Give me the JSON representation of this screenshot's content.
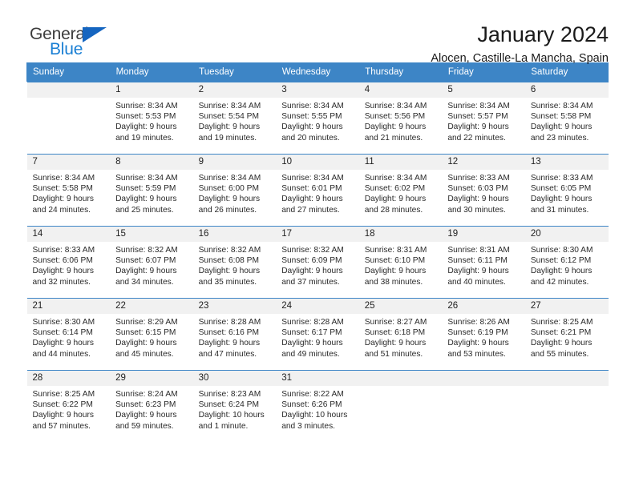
{
  "brand": {
    "name_top": "General",
    "name_bottom": "Blue",
    "accent_color": "#1565c0",
    "blue_text_color": "#1a7fd4"
  },
  "header": {
    "title": "January 2024",
    "subtitle": "Alocen, Castille-La Mancha, Spain"
  },
  "theme": {
    "header_row_bg": "#3d85c6",
    "daynum_bg": "#f1f1f1",
    "grid_line": "#3d85c6"
  },
  "weekdays": [
    "Sunday",
    "Monday",
    "Tuesday",
    "Wednesday",
    "Thursday",
    "Friday",
    "Saturday"
  ],
  "weeks": [
    [
      {
        "day": "",
        "sunrise": "",
        "sunset": "",
        "daylight_line1": "",
        "daylight_line2": ""
      },
      {
        "day": "1",
        "sunrise": "Sunrise: 8:34 AM",
        "sunset": "Sunset: 5:53 PM",
        "daylight_line1": "Daylight: 9 hours",
        "daylight_line2": "and 19 minutes."
      },
      {
        "day": "2",
        "sunrise": "Sunrise: 8:34 AM",
        "sunset": "Sunset: 5:54 PM",
        "daylight_line1": "Daylight: 9 hours",
        "daylight_line2": "and 19 minutes."
      },
      {
        "day": "3",
        "sunrise": "Sunrise: 8:34 AM",
        "sunset": "Sunset: 5:55 PM",
        "daylight_line1": "Daylight: 9 hours",
        "daylight_line2": "and 20 minutes."
      },
      {
        "day": "4",
        "sunrise": "Sunrise: 8:34 AM",
        "sunset": "Sunset: 5:56 PM",
        "daylight_line1": "Daylight: 9 hours",
        "daylight_line2": "and 21 minutes."
      },
      {
        "day": "5",
        "sunrise": "Sunrise: 8:34 AM",
        "sunset": "Sunset: 5:57 PM",
        "daylight_line1": "Daylight: 9 hours",
        "daylight_line2": "and 22 minutes."
      },
      {
        "day": "6",
        "sunrise": "Sunrise: 8:34 AM",
        "sunset": "Sunset: 5:58 PM",
        "daylight_line1": "Daylight: 9 hours",
        "daylight_line2": "and 23 minutes."
      }
    ],
    [
      {
        "day": "7",
        "sunrise": "Sunrise: 8:34 AM",
        "sunset": "Sunset: 5:58 PM",
        "daylight_line1": "Daylight: 9 hours",
        "daylight_line2": "and 24 minutes."
      },
      {
        "day": "8",
        "sunrise": "Sunrise: 8:34 AM",
        "sunset": "Sunset: 5:59 PM",
        "daylight_line1": "Daylight: 9 hours",
        "daylight_line2": "and 25 minutes."
      },
      {
        "day": "9",
        "sunrise": "Sunrise: 8:34 AM",
        "sunset": "Sunset: 6:00 PM",
        "daylight_line1": "Daylight: 9 hours",
        "daylight_line2": "and 26 minutes."
      },
      {
        "day": "10",
        "sunrise": "Sunrise: 8:34 AM",
        "sunset": "Sunset: 6:01 PM",
        "daylight_line1": "Daylight: 9 hours",
        "daylight_line2": "and 27 minutes."
      },
      {
        "day": "11",
        "sunrise": "Sunrise: 8:34 AM",
        "sunset": "Sunset: 6:02 PM",
        "daylight_line1": "Daylight: 9 hours",
        "daylight_line2": "and 28 minutes."
      },
      {
        "day": "12",
        "sunrise": "Sunrise: 8:33 AM",
        "sunset": "Sunset: 6:03 PM",
        "daylight_line1": "Daylight: 9 hours",
        "daylight_line2": "and 30 minutes."
      },
      {
        "day": "13",
        "sunrise": "Sunrise: 8:33 AM",
        "sunset": "Sunset: 6:05 PM",
        "daylight_line1": "Daylight: 9 hours",
        "daylight_line2": "and 31 minutes."
      }
    ],
    [
      {
        "day": "14",
        "sunrise": "Sunrise: 8:33 AM",
        "sunset": "Sunset: 6:06 PM",
        "daylight_line1": "Daylight: 9 hours",
        "daylight_line2": "and 32 minutes."
      },
      {
        "day": "15",
        "sunrise": "Sunrise: 8:32 AM",
        "sunset": "Sunset: 6:07 PM",
        "daylight_line1": "Daylight: 9 hours",
        "daylight_line2": "and 34 minutes."
      },
      {
        "day": "16",
        "sunrise": "Sunrise: 8:32 AM",
        "sunset": "Sunset: 6:08 PM",
        "daylight_line1": "Daylight: 9 hours",
        "daylight_line2": "and 35 minutes."
      },
      {
        "day": "17",
        "sunrise": "Sunrise: 8:32 AM",
        "sunset": "Sunset: 6:09 PM",
        "daylight_line1": "Daylight: 9 hours",
        "daylight_line2": "and 37 minutes."
      },
      {
        "day": "18",
        "sunrise": "Sunrise: 8:31 AM",
        "sunset": "Sunset: 6:10 PM",
        "daylight_line1": "Daylight: 9 hours",
        "daylight_line2": "and 38 minutes."
      },
      {
        "day": "19",
        "sunrise": "Sunrise: 8:31 AM",
        "sunset": "Sunset: 6:11 PM",
        "daylight_line1": "Daylight: 9 hours",
        "daylight_line2": "and 40 minutes."
      },
      {
        "day": "20",
        "sunrise": "Sunrise: 8:30 AM",
        "sunset": "Sunset: 6:12 PM",
        "daylight_line1": "Daylight: 9 hours",
        "daylight_line2": "and 42 minutes."
      }
    ],
    [
      {
        "day": "21",
        "sunrise": "Sunrise: 8:30 AM",
        "sunset": "Sunset: 6:14 PM",
        "daylight_line1": "Daylight: 9 hours",
        "daylight_line2": "and 44 minutes."
      },
      {
        "day": "22",
        "sunrise": "Sunrise: 8:29 AM",
        "sunset": "Sunset: 6:15 PM",
        "daylight_line1": "Daylight: 9 hours",
        "daylight_line2": "and 45 minutes."
      },
      {
        "day": "23",
        "sunrise": "Sunrise: 8:28 AM",
        "sunset": "Sunset: 6:16 PM",
        "daylight_line1": "Daylight: 9 hours",
        "daylight_line2": "and 47 minutes."
      },
      {
        "day": "24",
        "sunrise": "Sunrise: 8:28 AM",
        "sunset": "Sunset: 6:17 PM",
        "daylight_line1": "Daylight: 9 hours",
        "daylight_line2": "and 49 minutes."
      },
      {
        "day": "25",
        "sunrise": "Sunrise: 8:27 AM",
        "sunset": "Sunset: 6:18 PM",
        "daylight_line1": "Daylight: 9 hours",
        "daylight_line2": "and 51 minutes."
      },
      {
        "day": "26",
        "sunrise": "Sunrise: 8:26 AM",
        "sunset": "Sunset: 6:19 PM",
        "daylight_line1": "Daylight: 9 hours",
        "daylight_line2": "and 53 minutes."
      },
      {
        "day": "27",
        "sunrise": "Sunrise: 8:25 AM",
        "sunset": "Sunset: 6:21 PM",
        "daylight_line1": "Daylight: 9 hours",
        "daylight_line2": "and 55 minutes."
      }
    ],
    [
      {
        "day": "28",
        "sunrise": "Sunrise: 8:25 AM",
        "sunset": "Sunset: 6:22 PM",
        "daylight_line1": "Daylight: 9 hours",
        "daylight_line2": "and 57 minutes."
      },
      {
        "day": "29",
        "sunrise": "Sunrise: 8:24 AM",
        "sunset": "Sunset: 6:23 PM",
        "daylight_line1": "Daylight: 9 hours",
        "daylight_line2": "and 59 minutes."
      },
      {
        "day": "30",
        "sunrise": "Sunrise: 8:23 AM",
        "sunset": "Sunset: 6:24 PM",
        "daylight_line1": "Daylight: 10 hours",
        "daylight_line2": "and 1 minute."
      },
      {
        "day": "31",
        "sunrise": "Sunrise: 8:22 AM",
        "sunset": "Sunset: 6:26 PM",
        "daylight_line1": "Daylight: 10 hours",
        "daylight_line2": "and 3 minutes."
      },
      {
        "day": "",
        "sunrise": "",
        "sunset": "",
        "daylight_line1": "",
        "daylight_line2": ""
      },
      {
        "day": "",
        "sunrise": "",
        "sunset": "",
        "daylight_line1": "",
        "daylight_line2": ""
      },
      {
        "day": "",
        "sunrise": "",
        "sunset": "",
        "daylight_line1": "",
        "daylight_line2": ""
      }
    ]
  ]
}
